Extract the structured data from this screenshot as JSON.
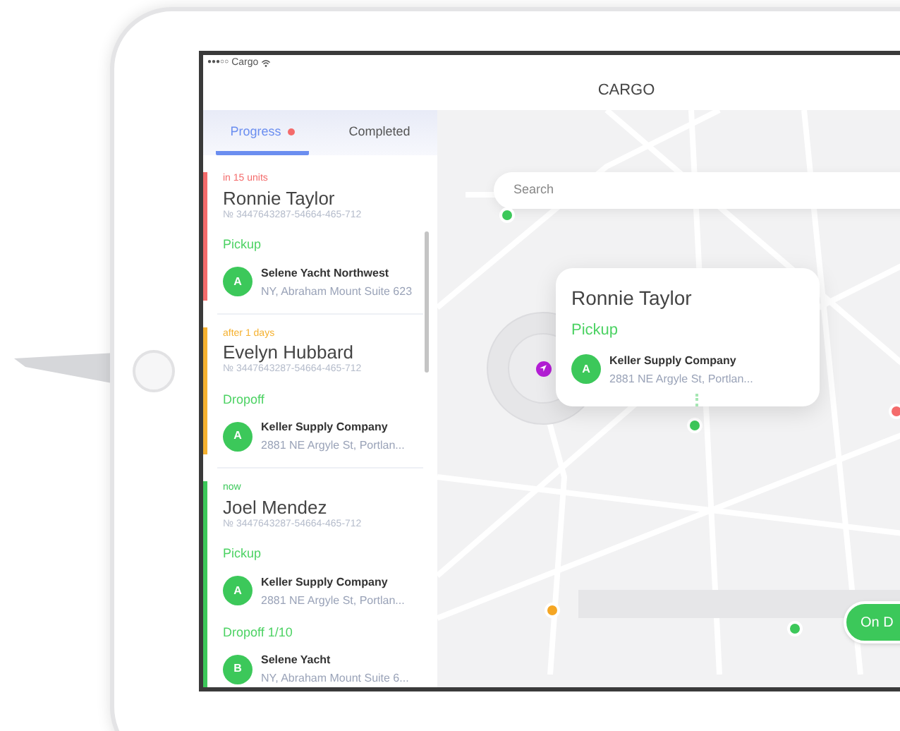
{
  "status_bar": {
    "signal": "●●●○○",
    "carrier": "Cargo"
  },
  "header": {
    "title": "CARGO"
  },
  "tabs": [
    {
      "label": "Progress",
      "selected": true,
      "dot": true
    },
    {
      "label": "Completed",
      "selected": false,
      "dot": false
    }
  ],
  "orders": [
    {
      "status": "in 15 units",
      "color": "#f46b6b",
      "name": "Ronnie Taylor",
      "number": "№ 3447643287-54664-465-712",
      "stops": [
        {
          "label": "Pickup",
          "letter": "A",
          "company": "Selene Yacht Northwest",
          "address": "NY, Abraham Mount Suite 623"
        }
      ]
    },
    {
      "status": "after 1 days",
      "color": "#f5b12f",
      "name": "Evelyn Hubbard",
      "number": "№ 3447643287-54664-465-712",
      "stops": [
        {
          "label": "Dropoff",
          "letter": "A",
          "company": "Keller Supply Company",
          "address": "2881 NE Argyle St, Portlan..."
        }
      ]
    },
    {
      "status": "now",
      "color": "#3cc85a",
      "name": "Joel Mendez",
      "number": "№ 3447643287-54664-465-712",
      "stops": [
        {
          "label": "Pickup",
          "letter": "A",
          "company": "Keller Supply Company",
          "address": "2881 NE Argyle St, Portlan..."
        },
        {
          "label": "Dropoff 1/10",
          "letter": "B",
          "company": "Selene Yacht",
          "address": "NY, Abraham Mount Suite 6..."
        }
      ]
    }
  ],
  "map": {
    "search": {
      "placeholder": "Search"
    },
    "markers": [
      {
        "kind": "dot",
        "color": "#3cc85a"
      },
      {
        "kind": "location",
        "color": "#b41ed6"
      },
      {
        "kind": "dot",
        "color": "#3cc85a"
      },
      {
        "kind": "dot",
        "color": "#f46b6b"
      },
      {
        "kind": "dot",
        "color": "#f5a623"
      },
      {
        "kind": "dot",
        "color": "#3cc85a"
      }
    ],
    "popup": {
      "name": "Ronnie Taylor",
      "stop": {
        "label": "Pickup",
        "letter": "A",
        "company": "Keller Supply Company",
        "address": "2881 NE Argyle St, Portlan..."
      }
    },
    "action_button": {
      "label": "On D"
    }
  }
}
